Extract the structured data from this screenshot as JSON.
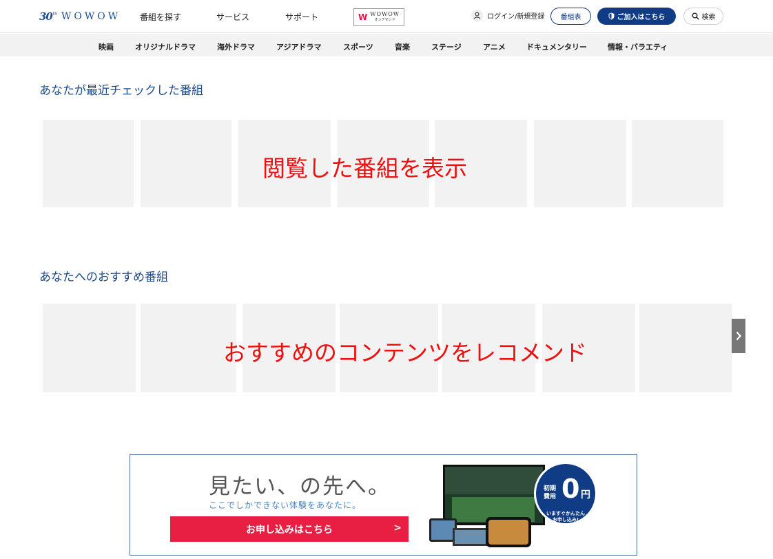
{
  "header": {
    "logo_30": "30",
    "logo_th": "th",
    "logo_word": "WOWOW",
    "nav": [
      "番組を探す",
      "サービス",
      "サポート"
    ],
    "ondemand_logo": "WOWOW",
    "ondemand_sub": "オンデマンド",
    "login": "ログイン/新規登録",
    "schedule_button": "番組表",
    "join_button": "ご加入はこちら",
    "search_button": "検索"
  },
  "categories": [
    "映画",
    "オリジナルドラマ",
    "海外ドラマ",
    "アジアドラマ",
    "スポーツ",
    "音楽",
    "ステージ",
    "アニメ",
    "ドキュメンタリー",
    "情報・バラエティ"
  ],
  "recent": {
    "title": "あなたが最近チェックした番組",
    "overlay": "閲覧した番組を表示"
  },
  "recommend": {
    "title": "あなたへのおすすめ番組",
    "overlay": "おすすめのコンテンツをレコメンド"
  },
  "banner": {
    "headline": "見たい、の先へ。",
    "subline": "ここでしかできない体験をあなたに。",
    "cta": "お申し込みはこちら",
    "cta_arrow": ">",
    "badge_label_1": "初期",
    "badge_label_2": "費用",
    "badge_number": "0",
    "badge_unit": "円",
    "badge_bottom_1": "いますぐかんたん",
    "badge_bottom_2": "お申し込み!"
  },
  "colors": {
    "brand_blue": "#0f3c85",
    "title_blue": "#1a4a8a",
    "overlay_red": "#ee1010",
    "cta_red": "#e91e43",
    "card_gray": "#f2f2f2"
  }
}
